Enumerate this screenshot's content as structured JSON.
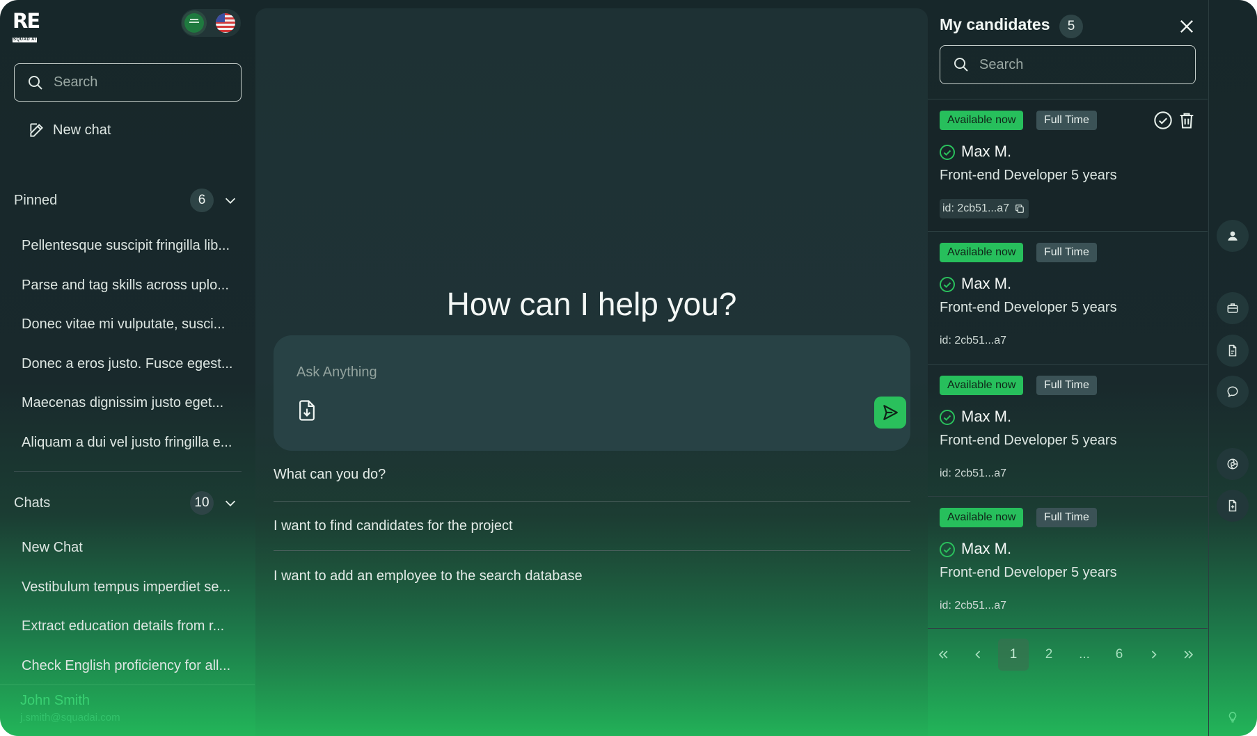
{
  "brand": {
    "logo_text": "RE",
    "logo_sub": "SQUAD AI"
  },
  "languages": [
    "sa-flag",
    "us-flag"
  ],
  "sidebar": {
    "search_placeholder": "Search",
    "new_chat_label": "New chat",
    "pinned": {
      "label": "Pinned",
      "count": "6",
      "items": [
        "Pellentesque suscipit fringilla lib...",
        "Parse and tag skills across uplo...",
        "Donec vitae mi vulputate, susci...",
        "Donec a eros justo. Fusce egest...",
        "Maecenas dignissim justo eget...",
        "Aliquam a dui vel justo fringilla e..."
      ]
    },
    "chats": {
      "label": "Chats",
      "count": "10",
      "items": [
        "New Chat",
        "Vestibulum tempus imperdiet se...",
        "Extract education details from r...",
        "Check English proficiency for all..."
      ]
    },
    "user": {
      "name": "John Smith",
      "email": "j.smith@squadai.com"
    }
  },
  "main": {
    "title": "How can I help you?",
    "input_placeholder": "Ask Anything",
    "suggestions": [
      "What can you do?",
      "I want to find candidates for the project",
      "I want to add an employee to the search database"
    ]
  },
  "panel": {
    "title": "My candidates",
    "count": "5",
    "search_placeholder": "Search",
    "candidates": [
      {
        "availability": "Available now",
        "type": "Full Time",
        "name": "Max M.",
        "role": "Front-end Developer 5 years",
        "id": "id: 2cb51...a7"
      },
      {
        "availability": "Available now",
        "type": "Full Time",
        "name": "Max M.",
        "role": "Front-end Developer 5 years",
        "id": "id: 2cb51...a7"
      },
      {
        "availability": "Available now",
        "type": "Full Time",
        "name": "Max M.",
        "role": "Front-end Developer 5 years",
        "id": "id: 2cb51...a7"
      },
      {
        "availability": "Available now",
        "type": "Full Time",
        "name": "Max M.",
        "role": "Front-end Developer 5 years",
        "id": "id: 2cb51...a7"
      }
    ],
    "pagination": {
      "pages": [
        "1",
        "2",
        "...",
        "6"
      ],
      "current": "1"
    }
  },
  "colors": {
    "accent": "#27bf5c",
    "background": "#17272a",
    "panel": "#284245"
  },
  "rail_icons": [
    "user-icon",
    "briefcase-icon",
    "document-icon",
    "chat-bubble-icon",
    "globe-icon",
    "file-plus-icon",
    "lightbulb-icon"
  ]
}
